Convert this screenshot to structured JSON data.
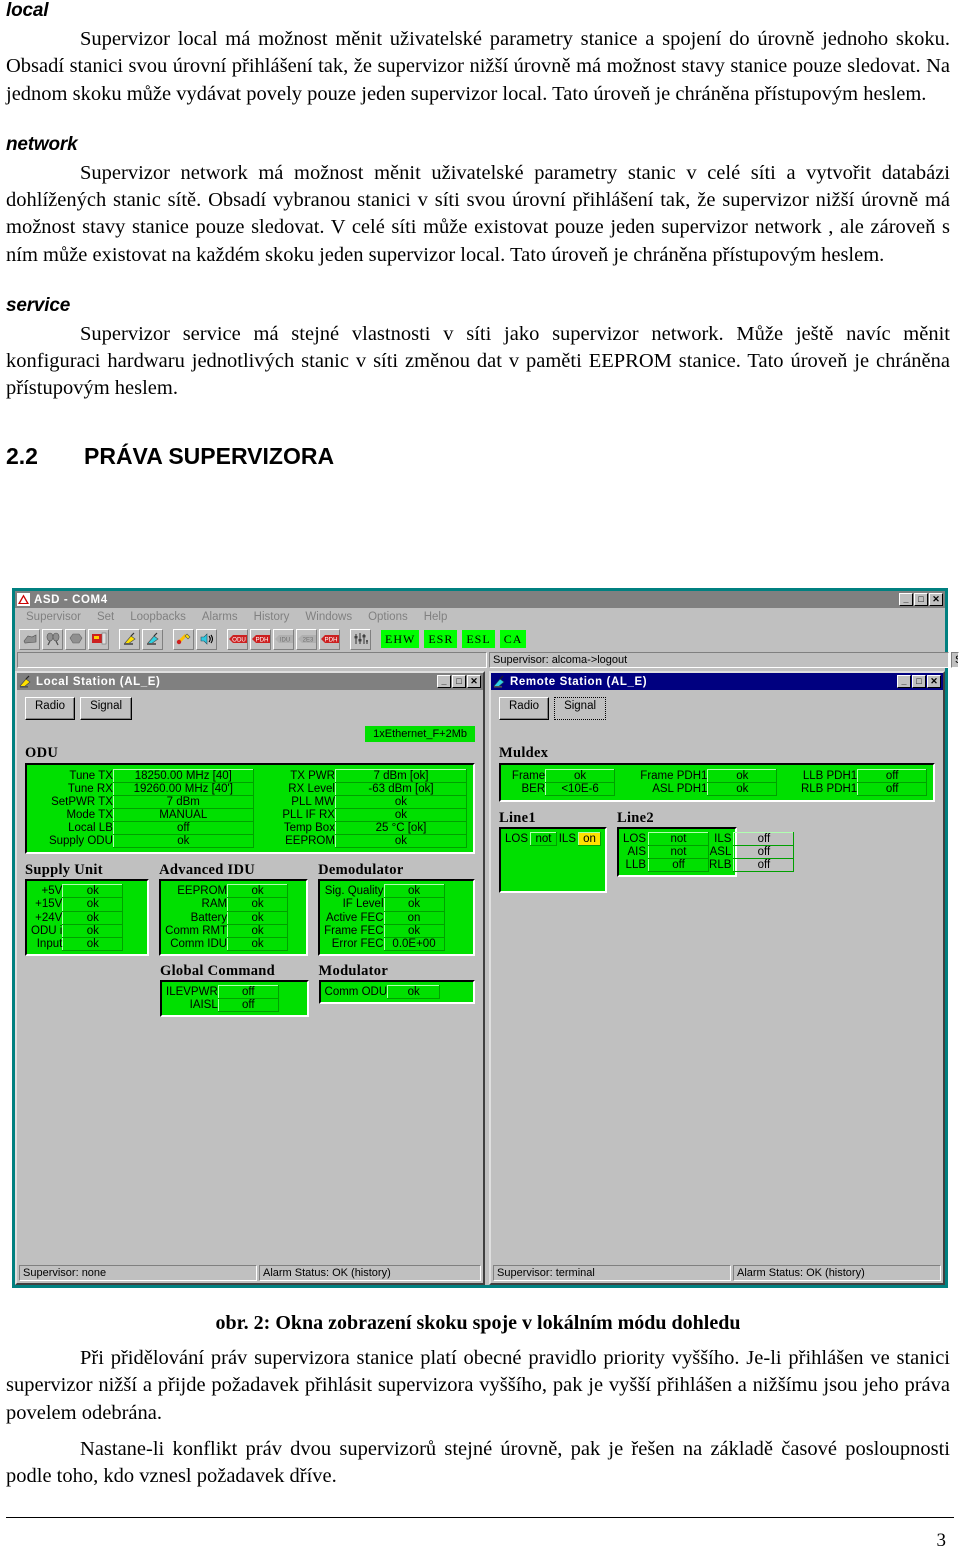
{
  "document": {
    "sections": [
      {
        "term": "local",
        "paragraphs": [
          "Supervizor local má možnost měnit uživatelské parametry stanice a spojení do úrovně jednoho skoku. Obsadí stanici svou úrovní přihlášení tak, že supervizor nižší úrovně má možnost stavy stanice pouze sledovat. Na jednom skoku může vydávat povely pouze jeden supervizor local. Tato úroveň je chráněna přístupovým heslem."
        ]
      },
      {
        "term": "network",
        "paragraphs": [
          "Supervizor network má možnost měnit uživatelské parametry stanic v celé síti a vytvořit databázi dohlížených stanic sítě. Obsadí vybranou stanici v síti svou úrovní přihlášení tak, že supervizor nižší úrovně má možnost stavy stanice pouze sledovat. V celé síti může existovat pouze jeden supervizor network , ale zároveň s ním může existovat na každém skoku jeden supervizor local. Tato úroveň je chráněna přístupovým heslem."
        ]
      },
      {
        "term": "service",
        "paragraphs": [
          "Supervizor service má stejné vlastnosti v síti jako supervizor network. Může ještě navíc měnit konfiguraci hardwaru jednotlivých stanic v síti změnou dat v paměti EEPROM stanice. Tato úroveň je chráněna přístupovým heslem."
        ]
      }
    ],
    "heading": {
      "number": "2.2",
      "title": "PRÁVA SUPERVIZORA"
    },
    "figure_caption": "obr. 2: Okna zobrazení skoku spoje v lokálním módu dohledu",
    "closing_paragraphs": [
      "Při přidělování práv supervizora stanice platí obecné pravidlo priority vyššího. Je-li přihlášen ve stanici supervizor nižší a přijde požadavek přihlásit supervizora vyššího, pak je vyšší přihlášen a nižšímu jsou jeho práva povelem odebrána.",
      "Nastane-li konflikt práv dvou supervizorů stejné úrovně, pak je řešen na základě časové posloupnosti podle toho, kdo vznesl požadavek dříve."
    ],
    "page_number": "3"
  },
  "app": {
    "title": "ASD - COM4",
    "window_buttons": {
      "minimize": "_",
      "maximize": "□",
      "close": "✕"
    },
    "menu": [
      {
        "label": "Supervisor",
        "accel": "S"
      },
      {
        "label": "Set",
        "accel": "t"
      },
      {
        "label": "Loopbacks",
        "accel": "L"
      },
      {
        "label": "Alarms",
        "accel": "A"
      },
      {
        "label": "History",
        "accel": "H"
      },
      {
        "label": "Windows",
        "accel": "W"
      },
      {
        "label": "Options",
        "accel": "O"
      },
      {
        "label": "Help",
        "accel": "p"
      }
    ],
    "toolbar_icons": [
      "connect-icon",
      "disconnect-icon",
      "stop-icon",
      "save-icon",
      "tx-radio-icon",
      "rx-radio-icon",
      "tools-icon",
      "speaker-icon",
      "odu-alarm-icon",
      "pdh-alarm-icon",
      "idu-gray-icon",
      "e1-gray-icon",
      "pdh-red-icon",
      "settings-icon"
    ],
    "status_badges": [
      "EHW",
      "ESR",
      "ESL",
      "CA"
    ],
    "status_bar": {
      "field1": "",
      "supervisor": "Supervisor: alcoma->logout",
      "station_address": "Station Address: LOCAL",
      "led": "red-led-icon"
    },
    "accent_green": "#00e000",
    "accent_yellow": "#ffe000",
    "title_active_color": "#000080",
    "title_inactive_color": "#808080"
  },
  "local_station": {
    "title": "Local Station (AL_E)",
    "tabs": [
      {
        "label": "Radio",
        "accel": "R",
        "selected": true
      },
      {
        "label": "Signal",
        "accel": "S",
        "selected": false
      }
    ],
    "ethernet_badge": "1xEthernet_F+2Mb",
    "groups": {
      "odu": {
        "label": "ODU",
        "left": [
          {
            "key": "Tune TX",
            "value": "18250.00 MHz  [40]"
          },
          {
            "key": "Tune RX",
            "value": "19260.00 MHz  [40']"
          },
          {
            "key": "SetPWR TX",
            "value": "7 dBm"
          },
          {
            "key": "Mode TX",
            "value": "MANUAL"
          },
          {
            "key": "Local LB",
            "value": "off"
          },
          {
            "key": "Supply ODU",
            "value": "ok"
          }
        ],
        "right": [
          {
            "key": "TX PWR",
            "value": "7 dBm [ok]"
          },
          {
            "key": "RX Level",
            "value": "-63 dBm [ok]"
          },
          {
            "key": "PLL MW",
            "value": "ok"
          },
          {
            "key": "PLL IF RX",
            "value": "ok"
          },
          {
            "key": "Temp Box",
            "value": "25 °C [ok]"
          },
          {
            "key": "EEPROM",
            "value": "ok"
          }
        ]
      },
      "supply_unit": {
        "label": "Supply Unit",
        "rows": [
          {
            "key": "+5V",
            "value": "ok"
          },
          {
            "key": "+15V",
            "value": "ok"
          },
          {
            "key": "+24V",
            "value": "ok"
          },
          {
            "key": "ODU  i",
            "value": "ok"
          },
          {
            "key": "Input",
            "value": "ok"
          }
        ]
      },
      "advanced_idu": {
        "label": "Advanced IDU",
        "rows": [
          {
            "key": "EEPROM",
            "value": "ok"
          },
          {
            "key": "RAM",
            "value": "ok"
          },
          {
            "key": "Battery",
            "value": "ok"
          },
          {
            "key": "Comm RMT",
            "value": "ok"
          },
          {
            "key": "Comm IDU",
            "value": "ok"
          }
        ]
      },
      "demodulator": {
        "label": "Demodulator",
        "rows": [
          {
            "key": "Sig. Quality",
            "value": "ok"
          },
          {
            "key": "IF Level",
            "value": "ok"
          },
          {
            "key": "Active FEC",
            "value": "on"
          },
          {
            "key": "Frame FEC",
            "value": "ok"
          },
          {
            "key": "Error FEC",
            "value": "0.0E+00"
          }
        ]
      },
      "global_command": {
        "label": "Global Command",
        "rows": [
          {
            "key": "ILEVPWR",
            "value": "off"
          },
          {
            "key": "IAISL",
            "value": "off"
          }
        ]
      },
      "modulator": {
        "label": "Modulator",
        "rows": [
          {
            "key": "Comm ODU",
            "value": "ok"
          }
        ]
      }
    },
    "status": {
      "supervisor": "Supervisor: none",
      "alarm": "Alarm Status: OK (history)"
    }
  },
  "remote_station": {
    "title": "Remote Station (AL_E)",
    "tabs": [
      {
        "label": "Radio",
        "accel": "R",
        "selected": false
      },
      {
        "label": "Signal",
        "accel": "S",
        "selected": true
      }
    ],
    "groups": {
      "muldex": {
        "label": "Muldex",
        "col1": [
          {
            "key": "Frame",
            "value": "ok"
          },
          {
            "key": "BER",
            "value": "<10E-6"
          }
        ],
        "col2": [
          {
            "key": "Frame PDH1",
            "value": "ok"
          },
          {
            "key": "ASL PDH1",
            "value": "ok"
          }
        ],
        "col3": [
          {
            "key": "LLB PDH1",
            "value": "off"
          },
          {
            "key": "RLB PDH1",
            "value": "off"
          }
        ]
      },
      "line1": {
        "label": "Line1",
        "rows": [
          [
            {
              "key": "LOS",
              "value": "not"
            },
            {
              "key": "ILS",
              "value": "on",
              "highlight": true
            }
          ]
        ]
      },
      "line2": {
        "label": "Line2",
        "rows": [
          [
            {
              "key": "LOS",
              "value": "not"
            },
            {
              "key": "ILS",
              "value": "off"
            }
          ],
          [
            {
              "key": "AIS",
              "value": "not"
            },
            {
              "key": "ASL",
              "value": "off"
            }
          ],
          [
            {
              "key": "LLB",
              "value": "off"
            },
            {
              "key": "RLB",
              "value": "off"
            }
          ]
        ]
      }
    },
    "status": {
      "supervisor": "Supervisor: terminal",
      "alarm": "Alarm Status: OK (history)"
    }
  }
}
